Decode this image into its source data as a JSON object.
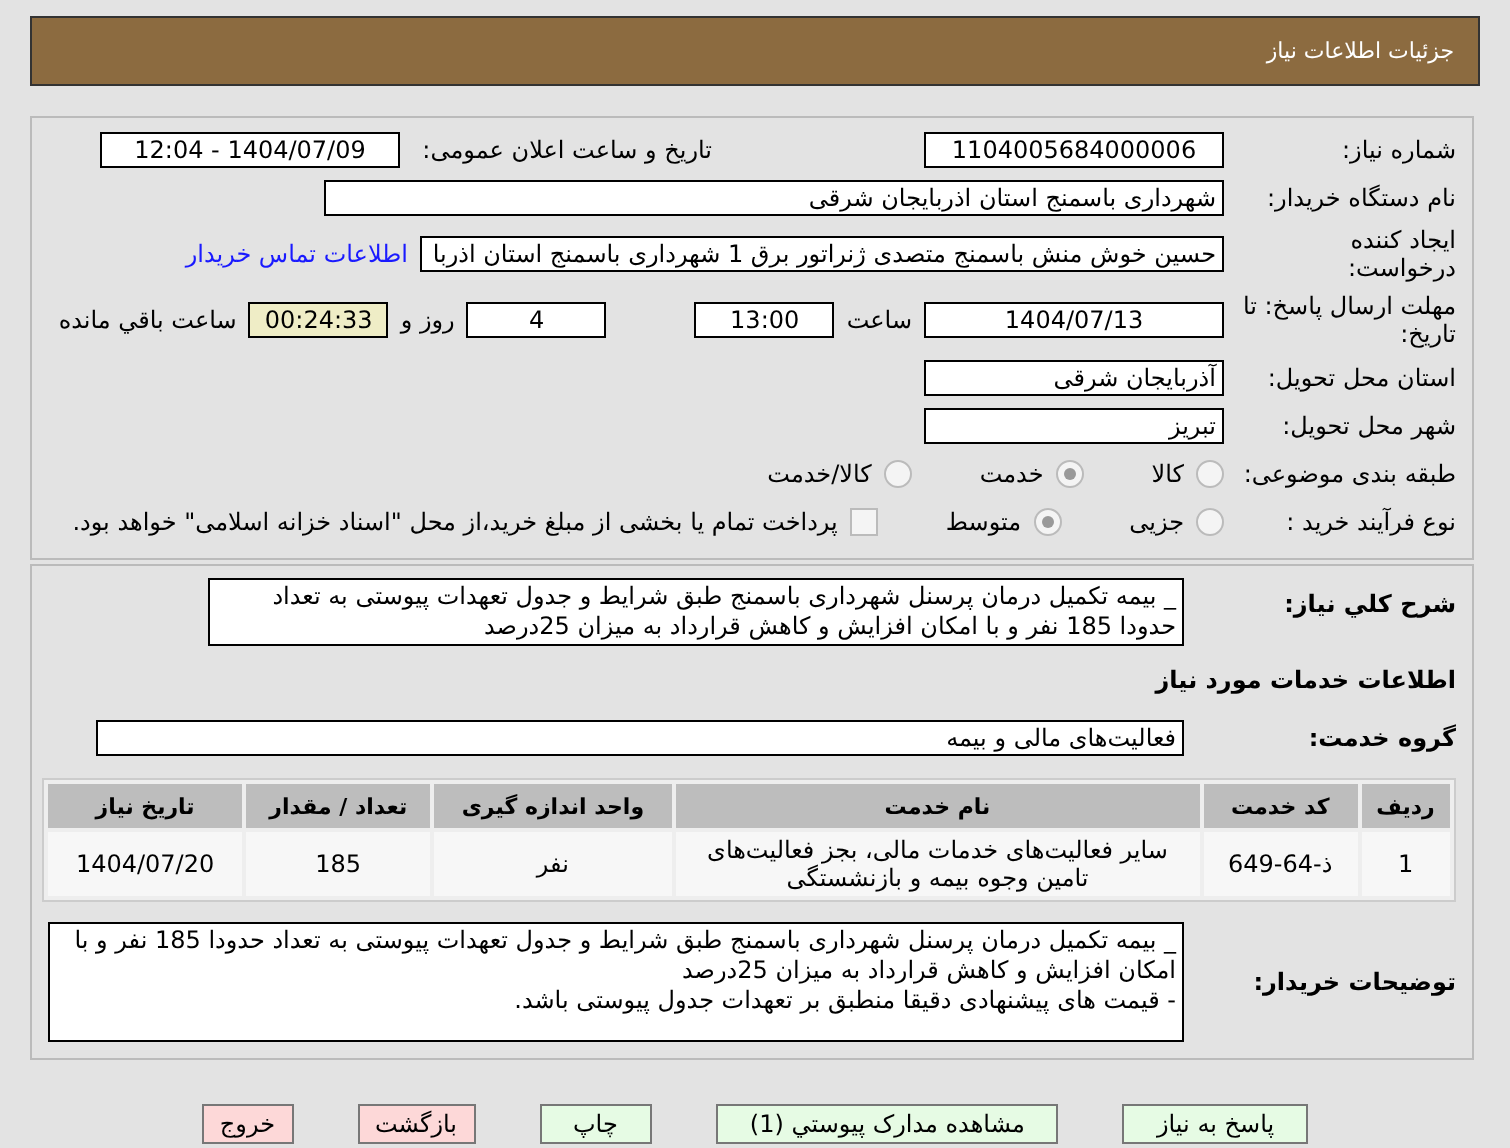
{
  "header": {
    "title": "جزئیات اطلاعات نیاز"
  },
  "need_info": {
    "need_number": {
      "label": "شماره نیاز:",
      "value": "1104005684000006"
    },
    "announce": {
      "label": "تاریخ و ساعت اعلان عمومی:",
      "value": "1404/07/09 - 12:04"
    },
    "buyer_org": {
      "label": "نام دستگاه خریدار:",
      "value": "شهرداری باسمنج استان اذربایجان شرقی"
    },
    "requester": {
      "label": "ایجاد کننده درخواست:",
      "value": "حسین خوش منش باسمنج متصدی ژنراتور برق 1 شهرداری باسمنج استان اذربا",
      "link": "اطلاعات تماس خریدار"
    },
    "deadline": {
      "label": "مهلت ارسال پاسخ: تا تاریخ:",
      "date": "1404/07/13",
      "time_label": "ساعت",
      "time": "13:00",
      "days": "4",
      "days_label": "روز و",
      "remaining": "00:24:33",
      "remaining_label": "ساعت باقي مانده"
    },
    "province": {
      "label": "استان محل تحویل:",
      "value": "آذربایجان شرقی"
    },
    "city": {
      "label": "شهر محل تحویل:",
      "value": "تبریز"
    },
    "category": {
      "label": "طبقه بندی موضوعی:",
      "options": [
        {
          "label": "کالا",
          "selected": false
        },
        {
          "label": "خدمت",
          "selected": true
        },
        {
          "label": "کالا/خدمت",
          "selected": false
        }
      ]
    },
    "process": {
      "label": "نوع فرآیند خرید :",
      "options": [
        {
          "label": "جزیی",
          "selected": false
        },
        {
          "label": "متوسط",
          "selected": true
        }
      ],
      "treasury": {
        "checked": false,
        "text": "پرداخت تمام یا بخشی از مبلغ خرید،از محل \"اسناد خزانه اسلامی\" خواهد بود."
      }
    }
  },
  "services": {
    "summary": {
      "label": "شرح کلي نیاز:",
      "value": "_ بیمه تکمیل درمان پرسنل شهرداری باسمنج طبق شرایط و جدول تعهدات پیوستی به تعداد حدودا 185 نفر و با امکان افزایش و کاهش قرارداد به میزان 25درصد"
    },
    "heading": "اطلاعات خدمات مورد نیاز",
    "group": {
      "label": "گروه خدمت:",
      "value": "فعالیت‌های مالی و بیمه"
    },
    "table": {
      "columns": [
        "ردیف",
        "کد خدمت",
        "نام خدمت",
        "واحد اندازه گیری",
        "تعداد / مقدار",
        "تاریخ نیاز"
      ],
      "rows": [
        [
          "1",
          "ذ-64-649",
          "سایر فعالیت‌های خدمات مالی، بجز فعالیت‌های تامین وجوه بیمه و بازنشستگی",
          "نفر",
          "185",
          "1404/07/20"
        ]
      ]
    },
    "notes": {
      "label": "توضیحات خریدار:",
      "lines": [
        "_ بیمه تکمیل درمان پرسنل شهرداری باسمنج طبق شرایط و جدول تعهدات پیوستی به تعداد حدودا 185 نفر و با امکان افزایش و کاهش قرارداد به میزان 25درصد",
        "- قیمت های پیشنهادی دقیقا منطبق بر تعهدات جدول پیوستی باشد."
      ]
    }
  },
  "buttons": [
    {
      "label": "پاسخ به نیاز",
      "kind": "normal"
    },
    {
      "label": "مشاهده مدارک پیوستي (1)",
      "kind": "normal"
    },
    {
      "label": "چاپ",
      "kind": "normal"
    },
    {
      "label": "بازگشت",
      "kind": "alert"
    },
    {
      "label": "خروج",
      "kind": "alert"
    }
  ]
}
